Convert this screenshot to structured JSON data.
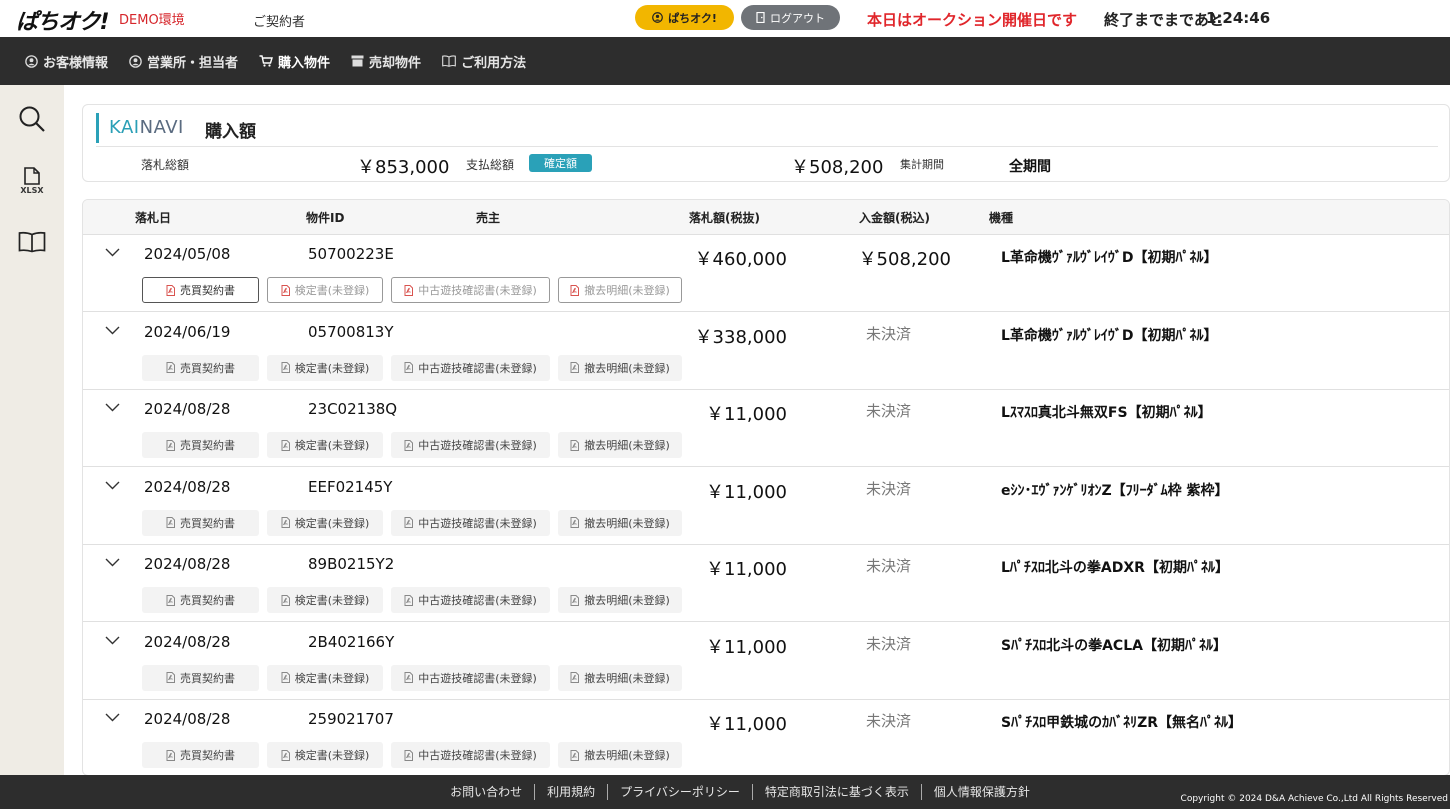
{
  "header": {
    "logo": "ぱちオク!",
    "env_label": "DEMO環境",
    "contractor_label": "ご契約者",
    "pachioku_button": "ぱちオク!",
    "logout_button": "ログアウト",
    "auction_message": "本日はオークション開催日です",
    "remaining_label": "終了までまであと",
    "remaining_time": "1:24:46"
  },
  "nav": {
    "items": [
      {
        "label": "お客様情報",
        "icon": "user-circle-icon"
      },
      {
        "label": "営業所・担当者",
        "icon": "user-circle-icon"
      },
      {
        "label": "購入物件",
        "icon": "cart-icon"
      },
      {
        "label": "売却物件",
        "icon": "box-icon"
      },
      {
        "label": "ご利用方法",
        "icon": "book-icon"
      }
    ]
  },
  "sidebar": {
    "xlsx_label": "XLSX"
  },
  "summary": {
    "brand_kai": "KAI",
    "brand_navi": "NAVI",
    "title": "購入額",
    "bid_total_label": "落札総額",
    "bid_total": "￥853,000",
    "pay_total_label": "支払総額",
    "pay_badge": "確定額",
    "pay_total": "￥508,200",
    "period_label": "集計期間",
    "period_value": "全期間"
  },
  "table": {
    "headers": {
      "date": "落札日",
      "item_id": "物件ID",
      "seller": "売主",
      "amount": "落札額(税抜)",
      "payment": "入金額(税込)",
      "model": "機種"
    },
    "doc_labels": [
      "売買契約書",
      "検定書(未登録)",
      "中古遊技確認書(未登録)",
      "撤去明細(未登録)"
    ],
    "rows": [
      {
        "date": "2024/05/08",
        "item_id": "50700223E",
        "amount": "￥460,000",
        "payment": "￥508,200",
        "model": "L革命機ｳﾞｧﾙｳﾞﾚｲｳﾞD【初期ﾊﾟﾈﾙ】"
      },
      {
        "date": "2024/06/19",
        "item_id": "05700813Y",
        "amount": "￥338,000",
        "payment": "未決済",
        "model": "L革命機ｳﾞｧﾙｳﾞﾚｲｳﾞD【初期ﾊﾟﾈﾙ】"
      },
      {
        "date": "2024/08/28",
        "item_id": "23C02138Q",
        "amount": "￥11,000",
        "payment": "未決済",
        "model": "Lｽﾏｽﾛ真北斗無双FS【初期ﾊﾟﾈﾙ】"
      },
      {
        "date": "2024/08/28",
        "item_id": "EEF02145Y",
        "amount": "￥11,000",
        "payment": "未決済",
        "model": "eｼﾝ･ｴｳﾞｧﾝｹﾞﾘｵﾝZ【ﾌﾘｰﾀﾞﾑ枠 紫枠】"
      },
      {
        "date": "2024/08/28",
        "item_id": "89B0215Y2",
        "amount": "￥11,000",
        "payment": "未決済",
        "model": "Lﾊﾟﾁｽﾛ北斗の拳ADXR【初期ﾊﾟﾈﾙ】"
      },
      {
        "date": "2024/08/28",
        "item_id": "2B402166Y",
        "amount": "￥11,000",
        "payment": "未決済",
        "model": "Sﾊﾟﾁｽﾛ北斗の拳ACLA【初期ﾊﾟﾈﾙ】"
      },
      {
        "date": "2024/08/28",
        "item_id": "259021707",
        "amount": "￥11,000",
        "payment": "未決済",
        "model": "Sﾊﾟﾁｽﾛ甲鉄城のｶﾊﾞﾈﾘZR【無名ﾊﾟﾈﾙ】"
      }
    ]
  },
  "footer": {
    "links": [
      "お問い合わせ",
      "利用規約",
      "プライバシーポリシー",
      "特定商取引法に基づく表示",
      "個人情報保護方針"
    ],
    "copyright": "Copyright © 2024 D&A Achieve Co.,Ltd All Rights Reserved"
  },
  "colors": {
    "accent": "#2aa1b8",
    "alert": "#e0262b",
    "nav_bg": "#2d2d2d",
    "pachioku_button": "#f2b600"
  }
}
